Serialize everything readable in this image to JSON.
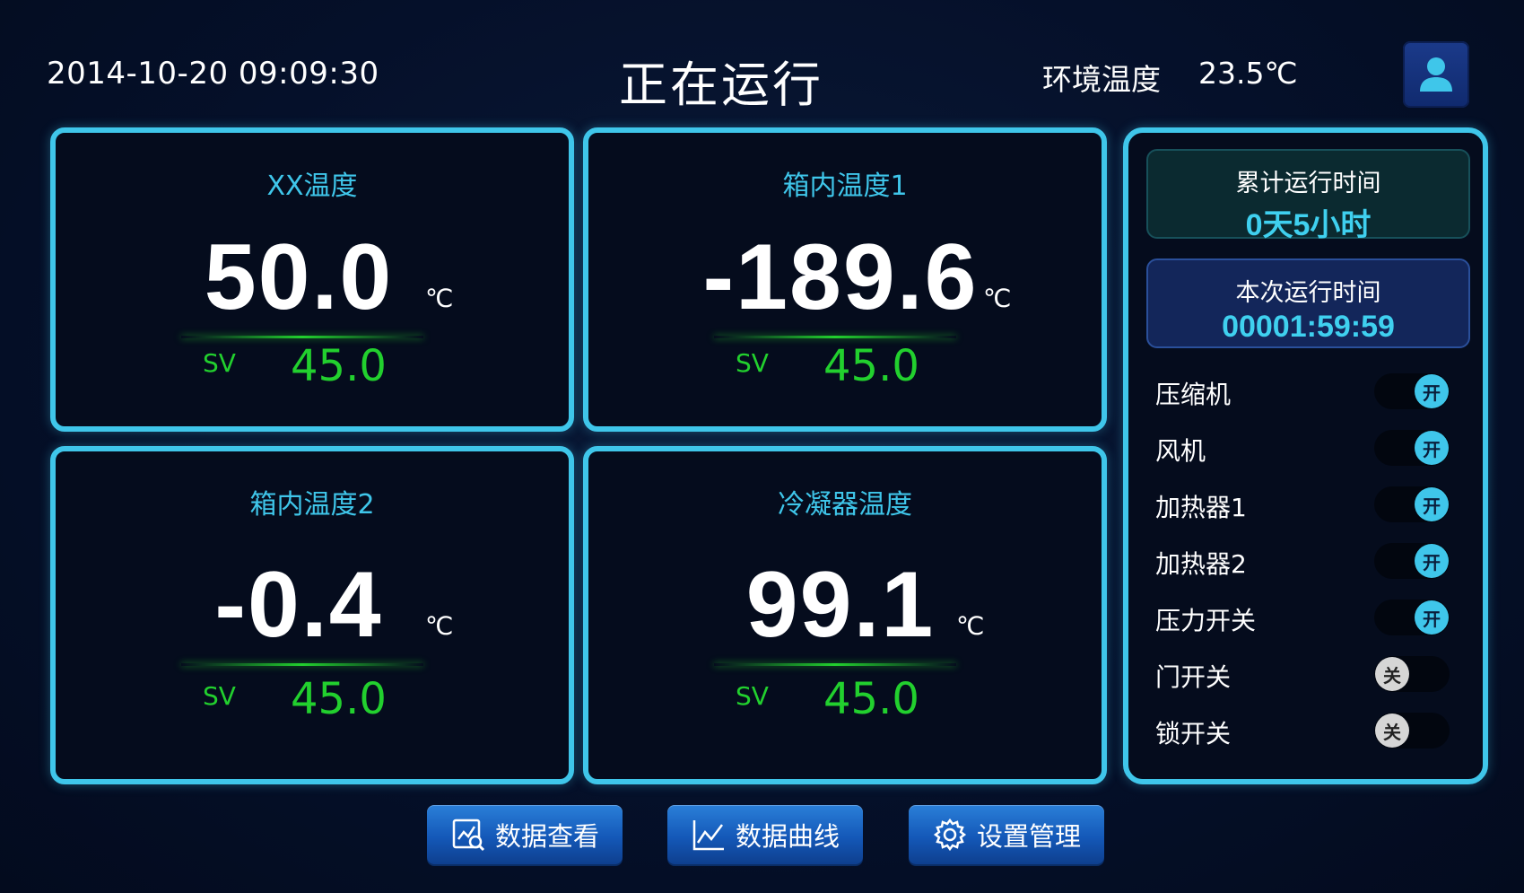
{
  "header": {
    "datetime": "2014-10-20 09:09:30",
    "status_title": "正在运行",
    "env_temp_label": "环境温度",
    "env_temp_value": "23.5℃",
    "user_icon": "user-icon"
  },
  "panels": [
    {
      "title": "XX温度",
      "value": "50.0",
      "unit": "℃",
      "sv_label": "SV",
      "sv_value": "45.0"
    },
    {
      "title": "箱内温度1",
      "value": "-189.6",
      "unit": "℃",
      "sv_label": "SV",
      "sv_value": "45.0"
    },
    {
      "title": "箱内温度2",
      "value": "-0.4",
      "unit": "℃",
      "sv_label": "SV",
      "sv_value": "45.0"
    },
    {
      "title": "冷凝器温度",
      "value": "99.1",
      "unit": "℃",
      "sv_label": "SV",
      "sv_value": "45.0"
    }
  ],
  "runtime": {
    "total_label": "累计运行时间",
    "total_value": "0天5小时",
    "current_label": "本次运行时间",
    "current_value": "00001:59:59"
  },
  "switches": [
    {
      "label": "压缩机",
      "state": "on",
      "state_text": "开"
    },
    {
      "label": "风机",
      "state": "on",
      "state_text": "开"
    },
    {
      "label": "加热器1",
      "state": "on",
      "state_text": "开"
    },
    {
      "label": "加热器2",
      "state": "on",
      "state_text": "开"
    },
    {
      "label": "压力开关",
      "state": "on",
      "state_text": "开"
    },
    {
      "label": "门开关",
      "state": "off",
      "state_text": "关"
    },
    {
      "label": "锁开关",
      "state": "off",
      "state_text": "关"
    }
  ],
  "nav_buttons": [
    {
      "label": "数据查看",
      "icon": "data-view-icon"
    },
    {
      "label": "数据曲线",
      "icon": "line-chart-icon"
    },
    {
      "label": "设置管理",
      "icon": "gear-icon"
    }
  ],
  "colors": {
    "accent": "#3fc6ea",
    "sv_green": "#22d02e",
    "background": "#040f24"
  }
}
